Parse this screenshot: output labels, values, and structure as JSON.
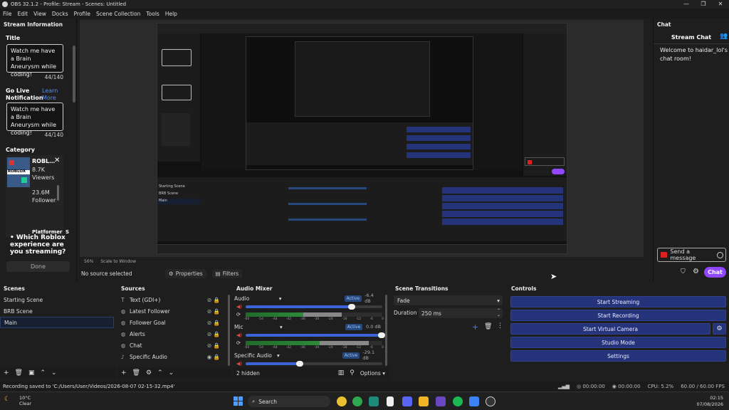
{
  "window": {
    "title": "OBS 32.1.2 - Profile: Stream - Scenes: Untitled"
  },
  "menu": [
    "File",
    "Edit",
    "View",
    "Docks",
    "Profile",
    "Scene Collection",
    "Tools",
    "Help"
  ],
  "stream_info": {
    "header": "Stream Information",
    "title_label": "Title",
    "title_value": "Watch me have a Brain Aneurysm while coding!",
    "title_count": "44/140",
    "golive_label": "Go Live Notification",
    "learn_more": "Learn More",
    "golive_value": "Watch me have a Brain Aneurysm while coding!",
    "golive_count": "44/140",
    "category_label": "Category",
    "category_name": "ROBL…",
    "category_viewers_num": "8.7K",
    "category_viewers_label": "Viewers",
    "category_followers_num": "23.6M",
    "category_followers_label": "Followers",
    "category_tag": "Platformer",
    "category_tag2": "S",
    "category_thumb_text": "ROBLOX",
    "prompt": "Which Roblox experience are you streaming?",
    "done_label": "Done"
  },
  "chat": {
    "header": "Chat",
    "title": "Stream Chat",
    "welcome": "Welcome to haidar_lol's chat room!",
    "send_placeholder": "Send a message",
    "chat_button": "Chat"
  },
  "preview": {
    "zoom": "56%",
    "scale_mode": "Scale to Window",
    "no_source": "No source selected",
    "properties_label": "Properties",
    "filters_label": "Filters"
  },
  "scenes": {
    "header": "Scenes",
    "items": [
      "Starting Scene",
      "BRB Scene",
      "Main"
    ],
    "selected": "Main"
  },
  "sources": {
    "header": "Sources",
    "items": [
      {
        "label": "Text (GDI+)",
        "icon": "text-icon"
      },
      {
        "label": "Latest Follower",
        "icon": "browser-icon"
      },
      {
        "label": "Follower Goal",
        "icon": "browser-icon"
      },
      {
        "label": "Alerts",
        "icon": "browser-icon"
      },
      {
        "label": "Chat",
        "icon": "browser-icon"
      },
      {
        "label": "Specific Audio",
        "icon": "audio-icon"
      }
    ]
  },
  "audio_mixer": {
    "header": "Audio Mixer",
    "channels": [
      {
        "name": "Audio",
        "status": "Active",
        "db": "-6.4 dB",
        "level": 0.78
      },
      {
        "name": "Mic",
        "status": "Active",
        "db": "0.0 dB",
        "level": 1.0
      },
      {
        "name": "Specific Audio",
        "status": "Active",
        "db": "-29.1 dB",
        "level": 0.4
      }
    ],
    "ticks": [
      "-60",
      "-54",
      "-48",
      "-42",
      "-36",
      "-30",
      "-24",
      "-18",
      "-12",
      "-6",
      "0"
    ],
    "hidden": "2 hidden",
    "options": "Options"
  },
  "transitions": {
    "header": "Scene Transitions",
    "selected": "Fade",
    "duration_label": "Duration",
    "duration_value": "250 ms"
  },
  "controls": {
    "header": "Controls",
    "buttons": [
      "Start Streaming",
      "Start Recording",
      "Start Virtual Camera",
      "Studio Mode",
      "Settings"
    ]
  },
  "status": {
    "message": "Recording saved to 'C:/Users/User/Videos/2026-08-07 02-15-32.mp4'",
    "stream_time": "00:00:00",
    "rec_time": "00:00:00",
    "cpu": "CPU: 5.2%",
    "fps": "60.00 / 60.00 FPS"
  },
  "taskbar": {
    "temp": "10°C",
    "weather": "Clear",
    "search": "Search",
    "time": "02:15",
    "date": "07/08/2026"
  },
  "colors": {
    "accent_button": "#25337b",
    "chat_purple": "#9147ff",
    "send_red": "#e02020",
    "active_badge": "#26487c"
  }
}
